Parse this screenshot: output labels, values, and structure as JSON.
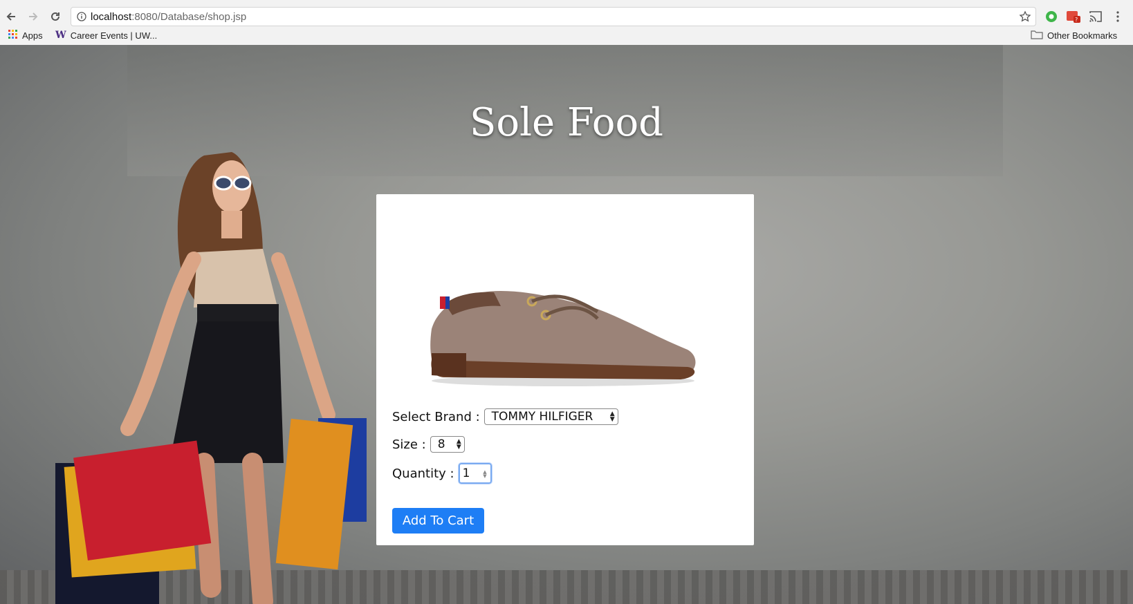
{
  "browser": {
    "url_host": "localhost",
    "url_rest": ":8080/Database/shop.jsp",
    "bookmarks": [
      "Apps",
      "Career Events | UW..."
    ],
    "other_bookmarks": "Other Bookmarks"
  },
  "page": {
    "title": "Sole Food",
    "brand_label": "Select Brand :",
    "brand_value": "TOMMY HILFIGER",
    "size_label": "Size :",
    "size_value": "8",
    "quantity_label": "Quantity :",
    "quantity_value": "1",
    "add_to_cart": "Add To Cart"
  },
  "colors": {
    "button": "#1e7ef5",
    "focus_ring": "#7aaaf0"
  }
}
